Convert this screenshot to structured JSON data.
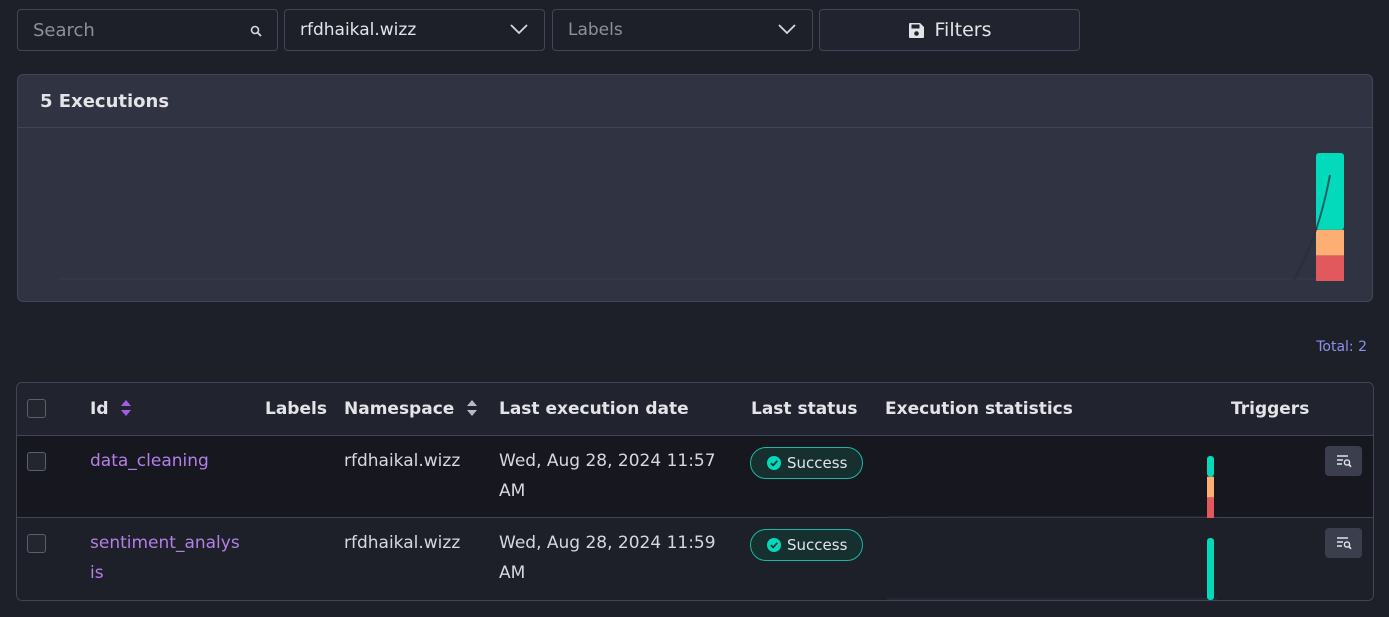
{
  "filters": {
    "search_placeholder": "Search",
    "namespace_value": "rfdhaikal.wizz",
    "labels_placeholder": "Labels",
    "filters_label": "Filters"
  },
  "executions_card": {
    "title": "5 Executions"
  },
  "chart_data": {
    "type": "bar",
    "categories": [
      ""
    ],
    "series": [
      {
        "name": "",
        "color": "#03dabb",
        "values": [
          3
        ]
      },
      {
        "name": "",
        "color": "#fdaf73",
        "values": [
          1
        ]
      },
      {
        "name": "",
        "color": "#e2595d",
        "values": [
          1
        ]
      }
    ],
    "title": "5 Executions",
    "xlabel": "",
    "ylabel": "",
    "stacked": true
  },
  "total_label": "Total: 2",
  "table": {
    "headers": {
      "id": "Id",
      "labels": "Labels",
      "namespace": "Namespace",
      "last_execution_date": "Last execution date",
      "last_status": "Last status",
      "execution_statistics": "Execution statistics",
      "triggers": "Triggers"
    },
    "rows": [
      {
        "id_line1": "data_cleaning",
        "id_line2": "",
        "namespace": "rfdhaikal.wizz",
        "date_line1": "Wed, Aug 28, 2024 11:57",
        "date_line2": "AM",
        "status": "Success"
      },
      {
        "id_line1": "sentiment_analys",
        "id_line2": "is",
        "namespace": "rfdhaikal.wizz",
        "date_line1": "Wed, Aug 28, 2024 11:59",
        "date_line2": "AM",
        "status": "Success"
      }
    ]
  },
  "colors": {
    "success": "#03dabb",
    "warning": "#fdaf73",
    "failed": "#e2595d",
    "link": "#b57ee8",
    "accent": "#8c90e8"
  }
}
